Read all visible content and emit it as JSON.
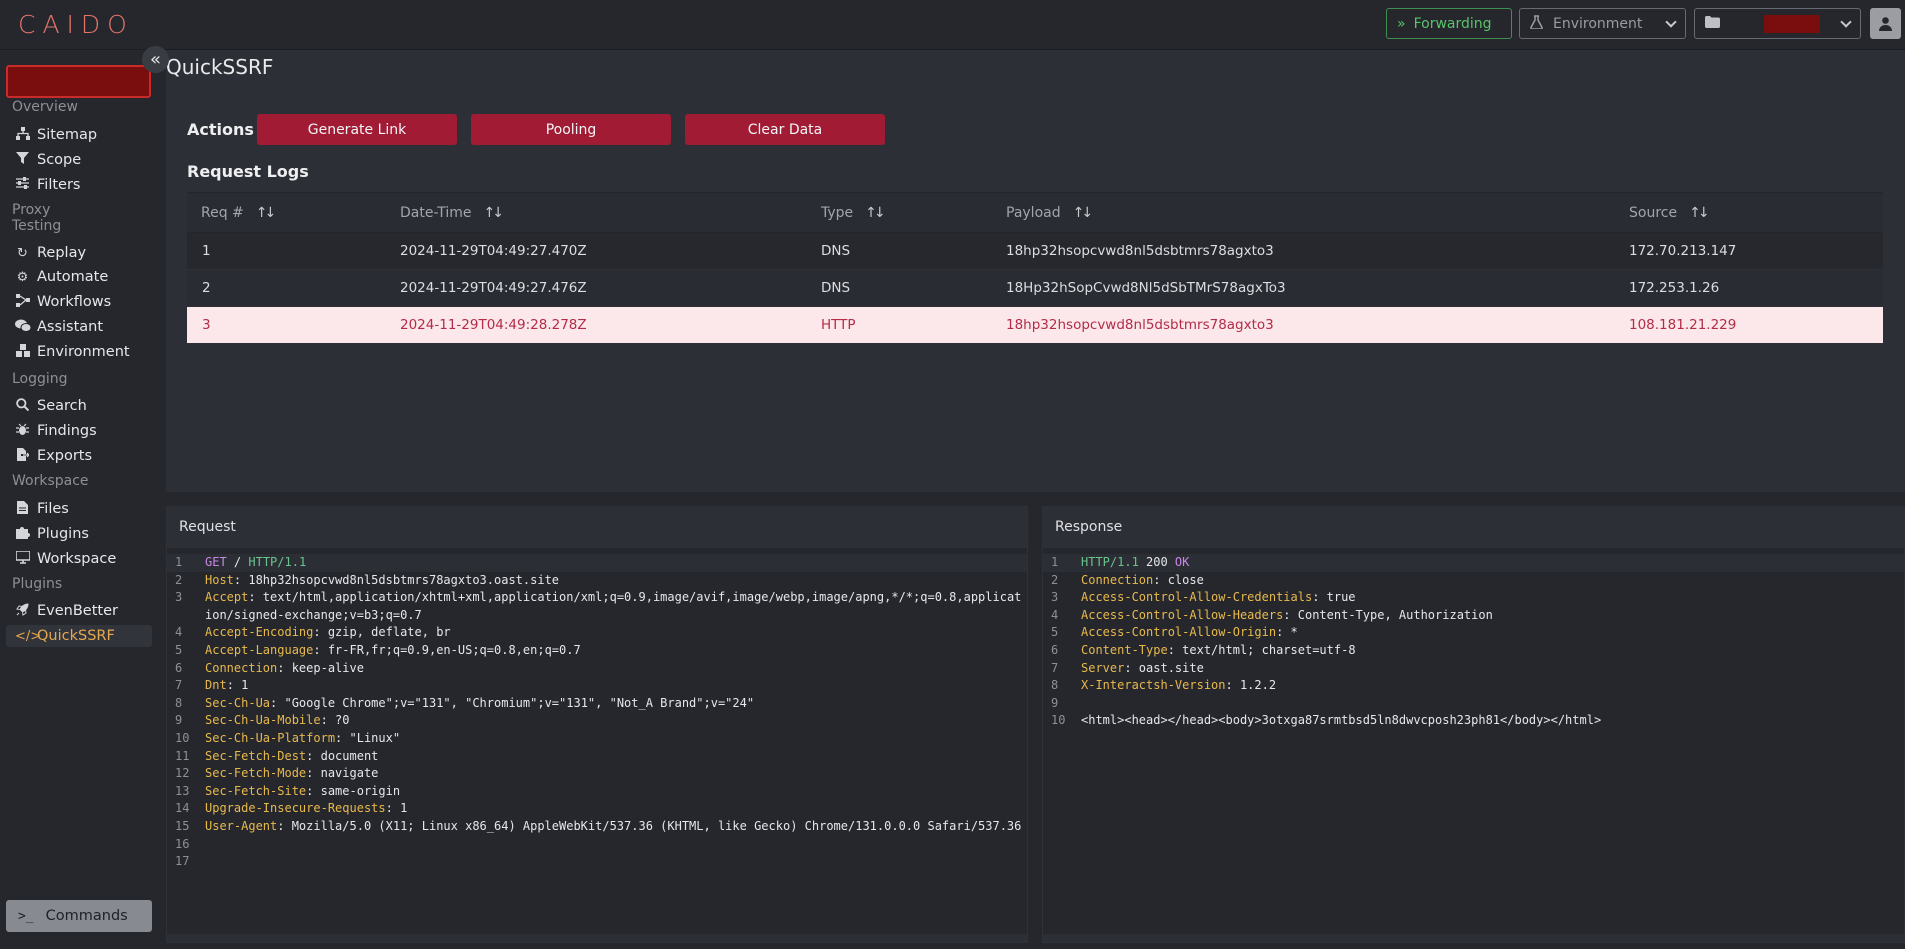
{
  "app": {
    "logo": "CAIDO"
  },
  "topbar": {
    "forwarding_label": "Forwarding",
    "environment_label": "Environment"
  },
  "sidebar": {
    "collapse_glyph": "«",
    "sections": [
      {
        "title": "Overview",
        "items": [
          "Sitemap",
          "Scope",
          "Filters"
        ]
      },
      {
        "title": "Proxy",
        "items": []
      },
      {
        "title": "Testing",
        "items": [
          "Replay",
          "Automate",
          "Workflows",
          "Assistant",
          "Environment"
        ]
      },
      {
        "title": "Logging",
        "items": [
          "Search",
          "Findings",
          "Exports"
        ]
      },
      {
        "title": "Workspace",
        "items": [
          "Files",
          "Plugins",
          "Workspace"
        ]
      },
      {
        "title": "Plugins",
        "items": [
          "EvenBetter",
          "QuickSSRF"
        ]
      }
    ],
    "active_item": "QuickSSRF",
    "commands_label": "Commands"
  },
  "main": {
    "title": "QuickSSRF",
    "actions_label": "Actions",
    "buttons": [
      "Generate Link",
      "Pooling",
      "Clear Data"
    ],
    "logs_label": "Request Logs",
    "columns": [
      "Req #",
      "Date-Time",
      "Type",
      "Payload",
      "Source"
    ],
    "rows": [
      {
        "req": "1",
        "datetime": "2024-11-29T04:49:27.470Z",
        "type": "DNS",
        "payload": "18hp32hsopcvwd8nl5dsbtmrs78agxto3",
        "source": "172.70.213.147"
      },
      {
        "req": "2",
        "datetime": "2024-11-29T04:49:27.476Z",
        "type": "DNS",
        "payload": "18Hp32hSopCvwd8Nl5dSbTMrS78agxTo3",
        "source": "172.253.1.26"
      },
      {
        "req": "3",
        "datetime": "2024-11-29T04:49:28.278Z",
        "type": "HTTP",
        "payload": "18hp32hsopcvwd8nl5dsbtmrs78agxto3",
        "source": "108.181.21.229"
      }
    ],
    "selected_row": 3
  },
  "request": {
    "title": "Request",
    "method": "GET",
    "path": "/",
    "version": "HTTP/1.1",
    "headers": [
      [
        "Host",
        "18hp32hsopcvwd8nl5dsbtmrs78agxto3.oast.site"
      ],
      [
        "Accept",
        "text/html,application/xhtml+xml,application/xml;q=0.9,image/avif,image/webp,image/apng,*/*;q=0.8,application/signed-exchange;v=b3;q=0.7"
      ],
      [
        "Accept-Encoding",
        "gzip, deflate, br"
      ],
      [
        "Accept-Language",
        "fr-FR,fr;q=0.9,en-US;q=0.8,en;q=0.7"
      ],
      [
        "Connection",
        "keep-alive"
      ],
      [
        "Dnt",
        "1"
      ],
      [
        "Sec-Ch-Ua",
        "\"Google Chrome\";v=\"131\", \"Chromium\";v=\"131\", \"Not_A Brand\";v=\"24\""
      ],
      [
        "Sec-Ch-Ua-Mobile",
        "?0"
      ],
      [
        "Sec-Ch-Ua-Platform",
        "\"Linux\""
      ],
      [
        "Sec-Fetch-Dest",
        "document"
      ],
      [
        "Sec-Fetch-Mode",
        "navigate"
      ],
      [
        "Sec-Fetch-Site",
        "same-origin"
      ],
      [
        "Upgrade-Insecure-Requests",
        "1"
      ],
      [
        "User-Agent",
        "Mozilla/5.0 (X11; Linux x86_64) AppleWebKit/537.36 (KHTML, like Gecko) Chrome/131.0.0.0 Safari/537.36"
      ]
    ]
  },
  "response": {
    "title": "Response",
    "version": "HTTP/1.1",
    "status_code": "200",
    "status_text": "OK",
    "headers": [
      [
        "Connection",
        "close"
      ],
      [
        "Access-Control-Allow-Credentials",
        "true"
      ],
      [
        "Access-Control-Allow-Headers",
        "Content-Type, Authorization"
      ],
      [
        "Access-Control-Allow-Origin",
        "*"
      ],
      [
        "Content-Type",
        "text/html; charset=utf-8"
      ],
      [
        "Server",
        "oast.site"
      ],
      [
        "X-Interactsh-Version",
        "1.2.2"
      ]
    ],
    "body": "<html><head></head><body>3otxga87srmtbsd5ln8dwvcposh23ph81</body></html>"
  }
}
